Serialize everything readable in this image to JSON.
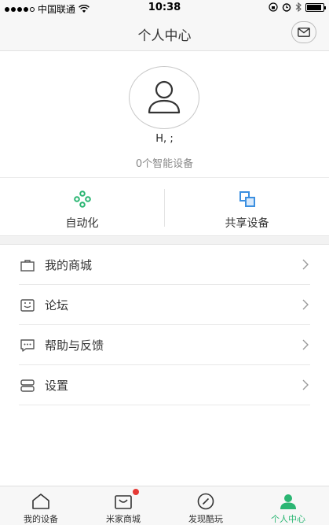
{
  "status_bar": {
    "carrier": "中国联通",
    "time": "10:38",
    "wifi_icon": "wifi-icon",
    "battery_level": 0.92
  },
  "nav": {
    "title": "个人中心",
    "mail_icon": "mail-icon"
  },
  "profile": {
    "avatar_icon": "user-avatar-icon",
    "username": "H, ;",
    "device_count": "0个智能设备"
  },
  "quick_actions": [
    {
      "label": "自动化",
      "icon": "automation-icon",
      "color": "#2bb673"
    },
    {
      "label": "共享设备",
      "icon": "share-device-icon",
      "color": "#3b8fe0"
    }
  ],
  "menu": [
    {
      "label": "我的商城",
      "icon": "shop-bag-icon"
    },
    {
      "label": "论坛",
      "icon": "forum-icon"
    },
    {
      "label": "帮助与反馈",
      "icon": "feedback-icon"
    },
    {
      "label": "设置",
      "icon": "settings-icon"
    }
  ],
  "tabs": [
    {
      "label": "我的设备",
      "icon": "home-icon"
    },
    {
      "label": "米家商城",
      "icon": "shop-icon",
      "badge": true
    },
    {
      "label": "发现酷玩",
      "icon": "compass-icon"
    },
    {
      "label": "个人中心",
      "icon": "profile-icon",
      "active": true
    }
  ],
  "colors": {
    "accent": "#2bb673",
    "badge": "#e53935",
    "share_blue": "#3b8fe0"
  }
}
